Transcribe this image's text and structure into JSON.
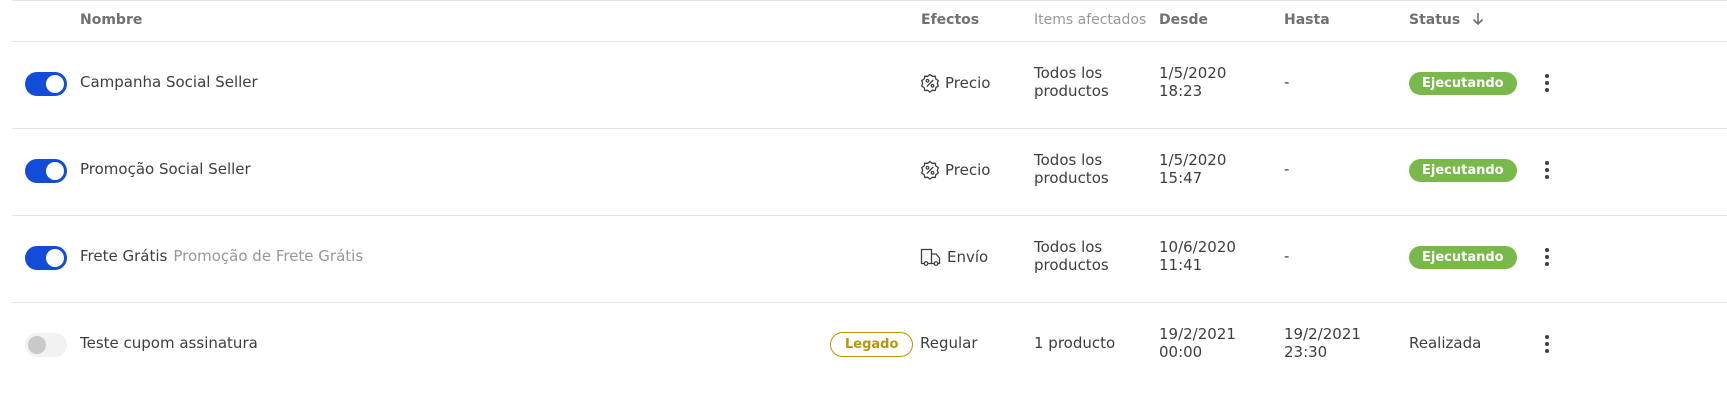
{
  "header": {
    "nombre": "Nombre",
    "efectos": "Efectos",
    "items": "Ítems afectados",
    "desde": "Desde",
    "hasta": "Hasta",
    "status": "Status"
  },
  "rows": [
    {
      "enabled": true,
      "name": "Campanha Social Seller",
      "subtitle": "",
      "effect": "Precio",
      "effect_icon": "percent-badge-icon",
      "items": "Todos los productos",
      "from_date": "1/5/2020",
      "from_time": "18:23",
      "to": "-",
      "status": "Ejecutando"
    },
    {
      "enabled": true,
      "name": "Promoção Social Seller",
      "subtitle": "",
      "effect": "Precio",
      "effect_icon": "percent-badge-icon",
      "items": "Todos los productos",
      "from_date": "1/5/2020",
      "from_time": "15:47",
      "to": "-",
      "status": "Ejecutando"
    },
    {
      "enabled": true,
      "name": "Frete Grátis",
      "subtitle": "Promoção de Frete Grátis",
      "effect": "Envío",
      "effect_icon": "shipping-icon",
      "items": "Todos los productos",
      "from_date": "10/6/2020",
      "from_time": "11:41",
      "to": "-",
      "status": "Ejecutando"
    },
    {
      "enabled": false,
      "name": "Teste cupom assinatura",
      "badge": "Legado",
      "effect": "Regular",
      "items": "1 producto",
      "from_date": "19/2/2021",
      "from_time": "00:00",
      "to_date": "19/2/2021",
      "to_time": "23:30",
      "status": "Realizada"
    }
  ],
  "colors": {
    "toggle_on": "#134cd8",
    "status_running": "#79b94c",
    "legacy_badge": "#b8960c"
  }
}
